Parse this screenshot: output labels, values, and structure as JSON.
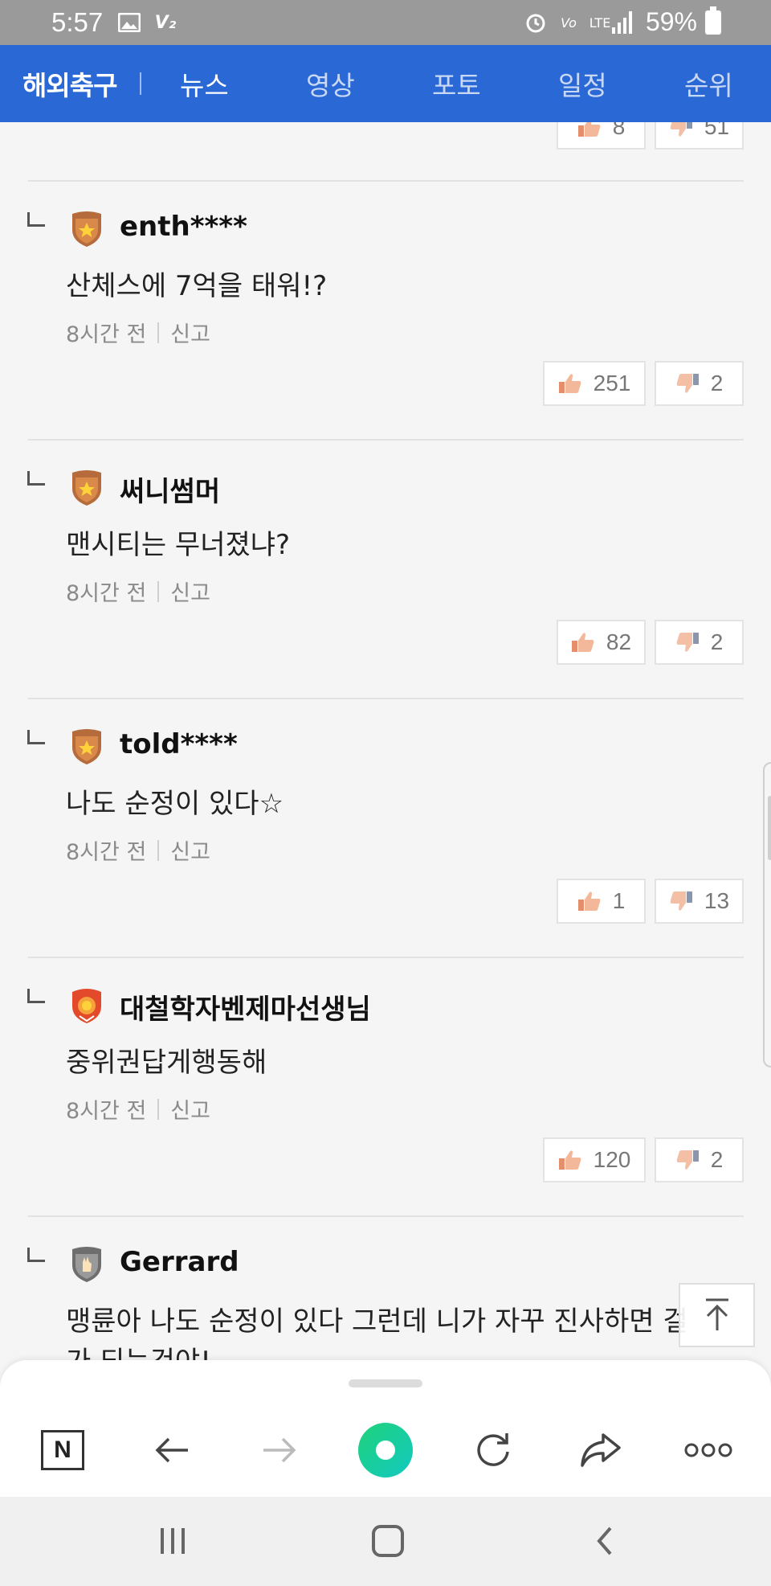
{
  "status_bar": {
    "time": "5:57",
    "battery": "59%",
    "network": "LTE",
    "icons": [
      "gallery-icon",
      "v2-icon",
      "alarm-icon",
      "volte-icon",
      "lte-icon",
      "signal-icon",
      "battery-icon"
    ]
  },
  "nav": {
    "brand": "해외축구",
    "tabs": [
      "뉴스",
      "영상",
      "포토",
      "일정",
      "순위"
    ],
    "active_tab": "뉴스",
    "color": "#2a68d6"
  },
  "top_partial": {
    "likes": "8",
    "dislikes": "51"
  },
  "comments": [
    {
      "user": "enth****",
      "text": "산체스에 7억을 태워!?",
      "time": "8시간 전",
      "report": "신고",
      "likes": "251",
      "dislikes": "2",
      "badge": "bronze-star-badge"
    },
    {
      "user": "써니썸머",
      "text": "맨시티는 무너졌냐?",
      "time": "8시간 전",
      "report": "신고",
      "likes": "82",
      "dislikes": "2",
      "badge": "bronze-star-badge"
    },
    {
      "user": "told****",
      "text": "나도 순정이 있다☆",
      "time": "8시간 전",
      "report": "신고",
      "likes": "1",
      "dislikes": "13",
      "badge": "bronze-star-badge"
    },
    {
      "user": "대철학자벤제마선생님",
      "text": "중위권답게행동해",
      "time": "8시간 전",
      "report": "신고",
      "likes": "120",
      "dislikes": "2",
      "badge": "red-medal-badge"
    },
    {
      "user": "Gerrard",
      "text": "맹륜아 나도 순정이 있다 그런데 니가 자꾸 진사하면 걸",
      "text2": "가 되는건야!",
      "badge": "silver-hand-badge"
    }
  ],
  "toolbar": {
    "items": [
      "naver-home-icon",
      "back-arrow-icon",
      "forward-arrow-icon",
      "green-dot-icon",
      "refresh-icon",
      "share-icon",
      "more-icon"
    ],
    "home_letter": "N"
  },
  "system_nav": [
    "recent-apps-icon",
    "home-icon",
    "back-icon"
  ]
}
